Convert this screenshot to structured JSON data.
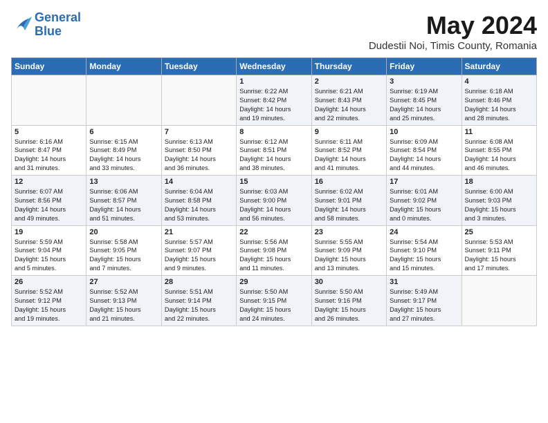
{
  "header": {
    "logo_line1": "General",
    "logo_line2": "Blue",
    "month_year": "May 2024",
    "subtitle": "Dudestii Noi, Timis County, Romania"
  },
  "weekdays": [
    "Sunday",
    "Monday",
    "Tuesday",
    "Wednesday",
    "Thursday",
    "Friday",
    "Saturday"
  ],
  "weeks": [
    [
      {
        "day": "",
        "info": ""
      },
      {
        "day": "",
        "info": ""
      },
      {
        "day": "",
        "info": ""
      },
      {
        "day": "1",
        "info": "Sunrise: 6:22 AM\nSunset: 8:42 PM\nDaylight: 14 hours\nand 19 minutes."
      },
      {
        "day": "2",
        "info": "Sunrise: 6:21 AM\nSunset: 8:43 PM\nDaylight: 14 hours\nand 22 minutes."
      },
      {
        "day": "3",
        "info": "Sunrise: 6:19 AM\nSunset: 8:45 PM\nDaylight: 14 hours\nand 25 minutes."
      },
      {
        "day": "4",
        "info": "Sunrise: 6:18 AM\nSunset: 8:46 PM\nDaylight: 14 hours\nand 28 minutes."
      }
    ],
    [
      {
        "day": "5",
        "info": "Sunrise: 6:16 AM\nSunset: 8:47 PM\nDaylight: 14 hours\nand 31 minutes."
      },
      {
        "day": "6",
        "info": "Sunrise: 6:15 AM\nSunset: 8:49 PM\nDaylight: 14 hours\nand 33 minutes."
      },
      {
        "day": "7",
        "info": "Sunrise: 6:13 AM\nSunset: 8:50 PM\nDaylight: 14 hours\nand 36 minutes."
      },
      {
        "day": "8",
        "info": "Sunrise: 6:12 AM\nSunset: 8:51 PM\nDaylight: 14 hours\nand 38 minutes."
      },
      {
        "day": "9",
        "info": "Sunrise: 6:11 AM\nSunset: 8:52 PM\nDaylight: 14 hours\nand 41 minutes."
      },
      {
        "day": "10",
        "info": "Sunrise: 6:09 AM\nSunset: 8:54 PM\nDaylight: 14 hours\nand 44 minutes."
      },
      {
        "day": "11",
        "info": "Sunrise: 6:08 AM\nSunset: 8:55 PM\nDaylight: 14 hours\nand 46 minutes."
      }
    ],
    [
      {
        "day": "12",
        "info": "Sunrise: 6:07 AM\nSunset: 8:56 PM\nDaylight: 14 hours\nand 49 minutes."
      },
      {
        "day": "13",
        "info": "Sunrise: 6:06 AM\nSunset: 8:57 PM\nDaylight: 14 hours\nand 51 minutes."
      },
      {
        "day": "14",
        "info": "Sunrise: 6:04 AM\nSunset: 8:58 PM\nDaylight: 14 hours\nand 53 minutes."
      },
      {
        "day": "15",
        "info": "Sunrise: 6:03 AM\nSunset: 9:00 PM\nDaylight: 14 hours\nand 56 minutes."
      },
      {
        "day": "16",
        "info": "Sunrise: 6:02 AM\nSunset: 9:01 PM\nDaylight: 14 hours\nand 58 minutes."
      },
      {
        "day": "17",
        "info": "Sunrise: 6:01 AM\nSunset: 9:02 PM\nDaylight: 15 hours\nand 0 minutes."
      },
      {
        "day": "18",
        "info": "Sunrise: 6:00 AM\nSunset: 9:03 PM\nDaylight: 15 hours\nand 3 minutes."
      }
    ],
    [
      {
        "day": "19",
        "info": "Sunrise: 5:59 AM\nSunset: 9:04 PM\nDaylight: 15 hours\nand 5 minutes."
      },
      {
        "day": "20",
        "info": "Sunrise: 5:58 AM\nSunset: 9:05 PM\nDaylight: 15 hours\nand 7 minutes."
      },
      {
        "day": "21",
        "info": "Sunrise: 5:57 AM\nSunset: 9:07 PM\nDaylight: 15 hours\nand 9 minutes."
      },
      {
        "day": "22",
        "info": "Sunrise: 5:56 AM\nSunset: 9:08 PM\nDaylight: 15 hours\nand 11 minutes."
      },
      {
        "day": "23",
        "info": "Sunrise: 5:55 AM\nSunset: 9:09 PM\nDaylight: 15 hours\nand 13 minutes."
      },
      {
        "day": "24",
        "info": "Sunrise: 5:54 AM\nSunset: 9:10 PM\nDaylight: 15 hours\nand 15 minutes."
      },
      {
        "day": "25",
        "info": "Sunrise: 5:53 AM\nSunset: 9:11 PM\nDaylight: 15 hours\nand 17 minutes."
      }
    ],
    [
      {
        "day": "26",
        "info": "Sunrise: 5:52 AM\nSunset: 9:12 PM\nDaylight: 15 hours\nand 19 minutes."
      },
      {
        "day": "27",
        "info": "Sunrise: 5:52 AM\nSunset: 9:13 PM\nDaylight: 15 hours\nand 21 minutes."
      },
      {
        "day": "28",
        "info": "Sunrise: 5:51 AM\nSunset: 9:14 PM\nDaylight: 15 hours\nand 22 minutes."
      },
      {
        "day": "29",
        "info": "Sunrise: 5:50 AM\nSunset: 9:15 PM\nDaylight: 15 hours\nand 24 minutes."
      },
      {
        "day": "30",
        "info": "Sunrise: 5:50 AM\nSunset: 9:16 PM\nDaylight: 15 hours\nand 26 minutes."
      },
      {
        "day": "31",
        "info": "Sunrise: 5:49 AM\nSunset: 9:17 PM\nDaylight: 15 hours\nand 27 minutes."
      },
      {
        "day": "",
        "info": ""
      }
    ]
  ]
}
